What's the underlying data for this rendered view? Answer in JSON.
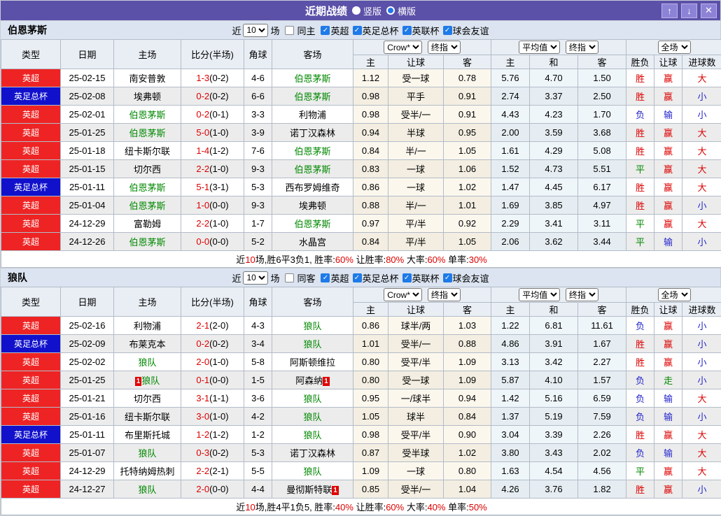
{
  "titlebar": {
    "title": "近期战绩",
    "radio_vertical": "竖版",
    "radio_horizontal": "横版",
    "selected_layout": "横版",
    "buttons": {
      "up": "↑",
      "down": "↓",
      "close": "✕"
    }
  },
  "filters": {
    "near_label": "近",
    "near_value": "10",
    "games_label": "场",
    "leagues": [
      "英超",
      "英足总杯",
      "英联杯",
      "球会友谊"
    ]
  },
  "columns": {
    "left": [
      "类型",
      "日期",
      "主场",
      "比分(半场)",
      "角球",
      "客场"
    ],
    "crow_sub": [
      "主",
      "让球",
      "客"
    ],
    "avg_sub": [
      "主",
      "和",
      "客"
    ],
    "result_sub": [
      "胜负",
      "让球",
      "进球数"
    ]
  },
  "odds_header": {
    "bookmaker": "Crow*",
    "final": "终指",
    "average": "平均值",
    "full": "全场"
  },
  "colors": {
    "titlebar_bg": "#5b51a8",
    "league_red": "#ee2424",
    "league_blue": "#1111cc",
    "focus_team_green": "#008800",
    "score_red": "#dd0000",
    "checkbox_blue": "#1e7ae8",
    "result_map": {
      "胜": "#dd0000",
      "平": "#008800",
      "负": "#2424cc",
      "赢": "#dd0000",
      "走": "#008800",
      "输": "#2424cc",
      "大": "#dd0000",
      "小": "#2424cc"
    }
  },
  "sections": [
    {
      "team": "伯恩茅斯",
      "same_label": "同主",
      "rows": [
        {
          "league": "英超",
          "league_color": "red",
          "date": "25-02-15",
          "home": "南安普敦",
          "home_is_focus": false,
          "home_red_card": false,
          "score_ft": "1-3",
          "score_ht": "(0-2)",
          "corners": "4-6",
          "away": "伯恩茅斯",
          "away_is_focus": true,
          "away_red_card": false,
          "crow_odds": [
            "1.12",
            "受一球",
            "0.78"
          ],
          "avg_odds": [
            "5.76",
            "4.70",
            "1.50"
          ],
          "results": [
            "胜",
            "赢",
            "大"
          ]
        },
        {
          "league": "英足总杯",
          "league_color": "blue",
          "date": "25-02-08",
          "home": "埃弗顿",
          "home_is_focus": false,
          "home_red_card": false,
          "score_ft": "0-2",
          "score_ht": "(0-2)",
          "corners": "6-6",
          "away": "伯恩茅斯",
          "away_is_focus": true,
          "away_red_card": false,
          "crow_odds": [
            "0.98",
            "平手",
            "0.91"
          ],
          "avg_odds": [
            "2.74",
            "3.37",
            "2.50"
          ],
          "results": [
            "胜",
            "赢",
            "小"
          ]
        },
        {
          "league": "英超",
          "league_color": "red",
          "date": "25-02-01",
          "home": "伯恩茅斯",
          "home_is_focus": true,
          "home_red_card": false,
          "score_ft": "0-2",
          "score_ht": "(0-1)",
          "corners": "3-3",
          "away": "利物浦",
          "away_is_focus": false,
          "away_red_card": false,
          "crow_odds": [
            "0.98",
            "受半/一",
            "0.91"
          ],
          "avg_odds": [
            "4.43",
            "4.23",
            "1.70"
          ],
          "results": [
            "负",
            "输",
            "小"
          ]
        },
        {
          "league": "英超",
          "league_color": "red",
          "date": "25-01-25",
          "home": "伯恩茅斯",
          "home_is_focus": true,
          "home_red_card": false,
          "score_ft": "5-0",
          "score_ht": "(1-0)",
          "corners": "3-9",
          "away": "诺丁汉森林",
          "away_is_focus": false,
          "away_red_card": false,
          "crow_odds": [
            "0.94",
            "半球",
            "0.95"
          ],
          "avg_odds": [
            "2.00",
            "3.59",
            "3.68"
          ],
          "results": [
            "胜",
            "赢",
            "大"
          ]
        },
        {
          "league": "英超",
          "league_color": "red",
          "date": "25-01-18",
          "home": "纽卡斯尔联",
          "home_is_focus": false,
          "home_red_card": false,
          "score_ft": "1-4",
          "score_ht": "(1-2)",
          "corners": "7-6",
          "away": "伯恩茅斯",
          "away_is_focus": true,
          "away_red_card": false,
          "crow_odds": [
            "0.84",
            "半/一",
            "1.05"
          ],
          "avg_odds": [
            "1.61",
            "4.29",
            "5.08"
          ],
          "results": [
            "胜",
            "赢",
            "大"
          ]
        },
        {
          "league": "英超",
          "league_color": "red",
          "date": "25-01-15",
          "home": "切尔西",
          "home_is_focus": false,
          "home_red_card": false,
          "score_ft": "2-2",
          "score_ht": "(1-0)",
          "corners": "9-3",
          "away": "伯恩茅斯",
          "away_is_focus": true,
          "away_red_card": false,
          "crow_odds": [
            "0.83",
            "一球",
            "1.06"
          ],
          "avg_odds": [
            "1.52",
            "4.73",
            "5.51"
          ],
          "results": [
            "平",
            "赢",
            "大"
          ]
        },
        {
          "league": "英足总杯",
          "league_color": "blue",
          "date": "25-01-11",
          "home": "伯恩茅斯",
          "home_is_focus": true,
          "home_red_card": false,
          "score_ft": "5-1",
          "score_ht": "(3-1)",
          "corners": "5-3",
          "away": "西布罗姆维奇",
          "away_is_focus": false,
          "away_red_card": false,
          "crow_odds": [
            "0.86",
            "一球",
            "1.02"
          ],
          "avg_odds": [
            "1.47",
            "4.45",
            "6.17"
          ],
          "results": [
            "胜",
            "赢",
            "大"
          ]
        },
        {
          "league": "英超",
          "league_color": "red",
          "date": "25-01-04",
          "home": "伯恩茅斯",
          "home_is_focus": true,
          "home_red_card": false,
          "score_ft": "1-0",
          "score_ht": "(0-0)",
          "corners": "9-3",
          "away": "埃弗顿",
          "away_is_focus": false,
          "away_red_card": false,
          "crow_odds": [
            "0.88",
            "半/一",
            "1.01"
          ],
          "avg_odds": [
            "1.69",
            "3.85",
            "4.97"
          ],
          "results": [
            "胜",
            "赢",
            "小"
          ]
        },
        {
          "league": "英超",
          "league_color": "red",
          "date": "24-12-29",
          "home": "富勒姆",
          "home_is_focus": false,
          "home_red_card": false,
          "score_ft": "2-2",
          "score_ht": "(1-0)",
          "corners": "1-7",
          "away": "伯恩茅斯",
          "away_is_focus": true,
          "away_red_card": false,
          "crow_odds": [
            "0.97",
            "平/半",
            "0.92"
          ],
          "avg_odds": [
            "2.29",
            "3.41",
            "3.11"
          ],
          "results": [
            "平",
            "赢",
            "大"
          ]
        },
        {
          "league": "英超",
          "league_color": "red",
          "date": "24-12-26",
          "home": "伯恩茅斯",
          "home_is_focus": true,
          "home_red_card": false,
          "score_ft": "0-0",
          "score_ht": "(0-0)",
          "corners": "5-2",
          "away": "水晶宫",
          "away_is_focus": false,
          "away_red_card": false,
          "crow_odds": [
            "0.84",
            "平/半",
            "1.05"
          ],
          "avg_odds": [
            "2.06",
            "3.62",
            "3.44"
          ],
          "results": [
            "平",
            "输",
            "小"
          ]
        }
      ],
      "summary": [
        {
          "text": "近",
          "red": false
        },
        {
          "text": "10",
          "red": true
        },
        {
          "text": "场,胜6平3负1, 胜率:",
          "red": false
        },
        {
          "text": "60%",
          "red": true
        },
        {
          "text": " 让胜率:",
          "red": false
        },
        {
          "text": "80%",
          "red": true
        },
        {
          "text": " 大率:",
          "red": false
        },
        {
          "text": "60%",
          "red": true
        },
        {
          "text": " 单率:",
          "red": false
        },
        {
          "text": "30%",
          "red": true
        }
      ]
    },
    {
      "team": "狼队",
      "same_label": "同客",
      "rows": [
        {
          "league": "英超",
          "league_color": "red",
          "date": "25-02-16",
          "home": "利物浦",
          "home_is_focus": false,
          "home_red_card": false,
          "score_ft": "2-1",
          "score_ht": "(2-0)",
          "corners": "4-3",
          "away": "狼队",
          "away_is_focus": true,
          "away_red_card": false,
          "crow_odds": [
            "0.86",
            "球半/两",
            "1.03"
          ],
          "avg_odds": [
            "1.22",
            "6.81",
            "11.61"
          ],
          "results": [
            "负",
            "赢",
            "小"
          ]
        },
        {
          "league": "英足总杯",
          "league_color": "blue",
          "date": "25-02-09",
          "home": "布莱克本",
          "home_is_focus": false,
          "home_red_card": false,
          "score_ft": "0-2",
          "score_ht": "(0-2)",
          "corners": "3-4",
          "away": "狼队",
          "away_is_focus": true,
          "away_red_card": false,
          "crow_odds": [
            "1.01",
            "受半/一",
            "0.88"
          ],
          "avg_odds": [
            "4.86",
            "3.91",
            "1.67"
          ],
          "results": [
            "胜",
            "赢",
            "小"
          ]
        },
        {
          "league": "英超",
          "league_color": "red",
          "date": "25-02-02",
          "home": "狼队",
          "home_is_focus": true,
          "home_red_card": false,
          "score_ft": "2-0",
          "score_ht": "(1-0)",
          "corners": "5-8",
          "away": "阿斯顿维拉",
          "away_is_focus": false,
          "away_red_card": false,
          "crow_odds": [
            "0.80",
            "受平/半",
            "1.09"
          ],
          "avg_odds": [
            "3.13",
            "3.42",
            "2.27"
          ],
          "results": [
            "胜",
            "赢",
            "小"
          ]
        },
        {
          "league": "英超",
          "league_color": "red",
          "date": "25-01-25",
          "home": "狼队",
          "home_is_focus": true,
          "home_red_card": true,
          "score_ft": "0-1",
          "score_ht": "(0-0)",
          "corners": "1-5",
          "away": "阿森纳",
          "away_is_focus": false,
          "away_red_card": true,
          "crow_odds": [
            "0.80",
            "受一球",
            "1.09"
          ],
          "avg_odds": [
            "5.87",
            "4.10",
            "1.57"
          ],
          "results": [
            "负",
            "走",
            "小"
          ]
        },
        {
          "league": "英超",
          "league_color": "red",
          "date": "25-01-21",
          "home": "切尔西",
          "home_is_focus": false,
          "home_red_card": false,
          "score_ft": "3-1",
          "score_ht": "(1-1)",
          "corners": "3-6",
          "away": "狼队",
          "away_is_focus": true,
          "away_red_card": false,
          "crow_odds": [
            "0.95",
            "一/球半",
            "0.94"
          ],
          "avg_odds": [
            "1.42",
            "5.16",
            "6.59"
          ],
          "results": [
            "负",
            "输",
            "大"
          ]
        },
        {
          "league": "英超",
          "league_color": "red",
          "date": "25-01-16",
          "home": "纽卡斯尔联",
          "home_is_focus": false,
          "home_red_card": false,
          "score_ft": "3-0",
          "score_ht": "(1-0)",
          "corners": "4-2",
          "away": "狼队",
          "away_is_focus": true,
          "away_red_card": false,
          "crow_odds": [
            "1.05",
            "球半",
            "0.84"
          ],
          "avg_odds": [
            "1.37",
            "5.19",
            "7.59"
          ],
          "results": [
            "负",
            "输",
            "小"
          ]
        },
        {
          "league": "英足总杯",
          "league_color": "blue",
          "date": "25-01-11",
          "home": "布里斯托城",
          "home_is_focus": false,
          "home_red_card": false,
          "score_ft": "1-2",
          "score_ht": "(1-2)",
          "corners": "1-2",
          "away": "狼队",
          "away_is_focus": true,
          "away_red_card": false,
          "crow_odds": [
            "0.98",
            "受平/半",
            "0.90"
          ],
          "avg_odds": [
            "3.04",
            "3.39",
            "2.26"
          ],
          "results": [
            "胜",
            "赢",
            "大"
          ]
        },
        {
          "league": "英超",
          "league_color": "red",
          "date": "25-01-07",
          "home": "狼队",
          "home_is_focus": true,
          "home_red_card": false,
          "score_ft": "0-3",
          "score_ht": "(0-2)",
          "corners": "5-3",
          "away": "诺丁汉森林",
          "away_is_focus": false,
          "away_red_card": false,
          "crow_odds": [
            "0.87",
            "受半球",
            "1.02"
          ],
          "avg_odds": [
            "3.80",
            "3.43",
            "2.02"
          ],
          "results": [
            "负",
            "输",
            "大"
          ]
        },
        {
          "league": "英超",
          "league_color": "red",
          "date": "24-12-29",
          "home": "托特纳姆热刺",
          "home_is_focus": false,
          "home_red_card": false,
          "score_ft": "2-2",
          "score_ht": "(2-1)",
          "corners": "5-5",
          "away": "狼队",
          "away_is_focus": true,
          "away_red_card": false,
          "crow_odds": [
            "1.09",
            "一球",
            "0.80"
          ],
          "avg_odds": [
            "1.63",
            "4.54",
            "4.56"
          ],
          "results": [
            "平",
            "赢",
            "大"
          ]
        },
        {
          "league": "英超",
          "league_color": "red",
          "date": "24-12-27",
          "home": "狼队",
          "home_is_focus": true,
          "home_red_card": false,
          "score_ft": "2-0",
          "score_ht": "(0-0)",
          "corners": "4-4",
          "away": "曼彻斯特联",
          "away_is_focus": false,
          "away_red_card": true,
          "crow_odds": [
            "0.85",
            "受半/一",
            "1.04"
          ],
          "avg_odds": [
            "4.26",
            "3.76",
            "1.82"
          ],
          "results": [
            "胜",
            "赢",
            "小"
          ]
        }
      ],
      "summary": [
        {
          "text": "近",
          "red": false
        },
        {
          "text": "10",
          "red": true
        },
        {
          "text": "场,胜4平1负5, 胜率:",
          "red": false
        },
        {
          "text": "40%",
          "red": true
        },
        {
          "text": " 让胜率:",
          "red": false
        },
        {
          "text": "60%",
          "red": true
        },
        {
          "text": " 大率:",
          "red": false
        },
        {
          "text": "40%",
          "red": true
        },
        {
          "text": " 单率:",
          "red": false
        },
        {
          "text": "50%",
          "red": true
        }
      ]
    }
  ]
}
